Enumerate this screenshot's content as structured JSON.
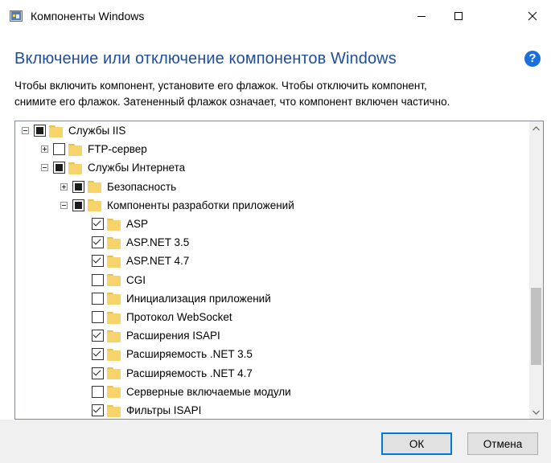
{
  "window": {
    "title": "Компоненты Windows"
  },
  "heading": "Включение или отключение компонентов Windows",
  "description_line1": "Чтобы включить компонент, установите его флажок. Чтобы отключить компонент,",
  "description_line2": "снимите его флажок. Затененный флажок означает, что компонент включен частично.",
  "tree": [
    {
      "label": "Службы IIS",
      "level": 0,
      "expander": "minus",
      "state": "partial"
    },
    {
      "label": "FTP-сервер",
      "level": 1,
      "expander": "plus",
      "state": "unchecked"
    },
    {
      "label": "Службы Интернета",
      "level": 1,
      "expander": "minus",
      "state": "partial"
    },
    {
      "label": "Безопасность",
      "level": 2,
      "expander": "plus",
      "state": "partial"
    },
    {
      "label": "Компоненты разработки приложений",
      "level": 2,
      "expander": "minus",
      "state": "partial"
    },
    {
      "label": "ASP",
      "level": 3,
      "expander": "none",
      "state": "checked"
    },
    {
      "label": "ASP.NET 3.5",
      "level": 3,
      "expander": "none",
      "state": "checked"
    },
    {
      "label": "ASP.NET 4.7",
      "level": 3,
      "expander": "none",
      "state": "checked"
    },
    {
      "label": "CGI",
      "level": 3,
      "expander": "none",
      "state": "unchecked"
    },
    {
      "label": "Инициализация приложений",
      "level": 3,
      "expander": "none",
      "state": "unchecked"
    },
    {
      "label": "Протокол WebSocket",
      "level": 3,
      "expander": "none",
      "state": "unchecked"
    },
    {
      "label": "Расширения ISAPI",
      "level": 3,
      "expander": "none",
      "state": "checked"
    },
    {
      "label": "Расширяемость .NET 3.5",
      "level": 3,
      "expander": "none",
      "state": "checked"
    },
    {
      "label": "Расширяемость .NET 4.7",
      "level": 3,
      "expander": "none",
      "state": "checked"
    },
    {
      "label": "Серверные включаемые модули",
      "level": 3,
      "expander": "none",
      "state": "unchecked"
    },
    {
      "label": "Фильтры ISAPI",
      "level": 3,
      "expander": "none",
      "state": "checked"
    }
  ],
  "buttons": {
    "ok": "ОК",
    "cancel": "Отмена"
  },
  "icons": {
    "app": "windows-features-icon",
    "help": "help-icon",
    "minimize": "minimize-icon",
    "maximize": "maximize-icon",
    "close": "close-icon"
  },
  "colors": {
    "heading": "#1f4e9c",
    "help": "#1a6fd9",
    "default_button_border": "#0078d7"
  }
}
